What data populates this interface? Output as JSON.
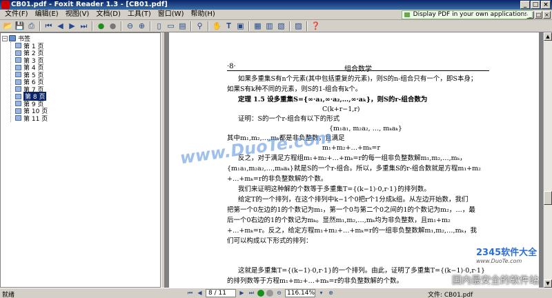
{
  "window": {
    "title": "CB01.pdf - Foxit Reader 1.3 - [CB01.pdf]",
    "controls": [
      "_",
      "□",
      "×"
    ]
  },
  "menu": {
    "items": [
      "文件(F)",
      "编辑(E)",
      "视图(V)",
      "文档(D)",
      "工具(T)",
      "窗口(W)",
      "帮助(H)"
    ],
    "promo": "Display PDF in your own applications"
  },
  "toolbar": {
    "icons": [
      "open-icon",
      "save-icon",
      "print-icon",
      "first-page-icon",
      "prev-page-icon",
      "next-page-icon",
      "last-page-icon",
      "go-back-icon",
      "go-forward-icon",
      "zoom-out-icon",
      "zoom-in-icon",
      "actual-size-icon",
      "fit-page-icon",
      "fit-width-icon",
      "find-icon",
      "hand-tool-icon",
      "text-select-icon",
      "snapshot-icon",
      "single-page-icon",
      "continuous-icon",
      "facing-icon",
      "bookmark-toggle-icon",
      "help-icon"
    ]
  },
  "bookmarks": {
    "root": "书签",
    "items": [
      {
        "label": "第 1 页",
        "selected": false
      },
      {
        "label": "第 2 页",
        "selected": false
      },
      {
        "label": "第 3 页",
        "selected": false
      },
      {
        "label": "第 4 页",
        "selected": false
      },
      {
        "label": "第 5 页",
        "selected": false
      },
      {
        "label": "第 6 页",
        "selected": false
      },
      {
        "label": "第 7 页",
        "selected": false
      },
      {
        "label": "第 8 页",
        "selected": true
      },
      {
        "label": "第 9 页",
        "selected": false
      },
      {
        "label": "第 10 页",
        "selected": false
      },
      {
        "label": "第 11 页",
        "selected": false
      }
    ]
  },
  "page": {
    "number": "·8·",
    "header_title": "组合数学",
    "lines": [
      "如果多重集S有n个元素(其中包括重复的元素)，则S的n-组合只有一个，即S本身；",
      "如果S有k种不同的元素，则S的1-组合有k个。",
      "定理 1.5   设多重集S={∞·a₁,∞·a₂,…,∞·aₖ}，则S的r-组合数为",
      "C(k+r−1,r)",
      "证明：S的一个r-组合有以下的形式",
      "{m₁a₁, m₂a₂, …, mₖaₖ}",
      "其中m₁,m₂,…,mₖ都是非负整数，且满足",
      "m₁+m₂+…+mₖ=r",
      "反之，对于满足方程组m₁+m₂+…+mₖ=r的每一组非负整数解m₁,m₂,…,mₖ，",
      "{m₁a₁,m₂a₂,…,mₖaₖ}就是S的一个r-组合。所以，多重集S的r-组合数就是方程m₁+m₂",
      "+…+mₖ=r的非负整数解的个数。",
      "我们来证明这种解的个数等于多重集T={(k−1)·0,r·1}的排列数。",
      "给定T的一个排列，在这个排列中k−1个0把r个1分成k组。从左边开始数，我们",
      "把第一个0左边的1的个数记为m₁，第一个0与第二个0之间的1的个数记为m₂，…，最",
      "后一个0右边的1的个数记为mₖ。显然m₁,m₂,…,mₖ均为非负整数，且m₁+m₂",
      "+…+mₖ=r。反之，给定方程m₁+m₂+…+mₖ=r的一组非负整数解m₁,m₂,…,mₖ，我",
      "们可以构成以下形式的排列：",
      "这就是多重集T={(k−1)·0,r·1}的一个排列。由此，证明了多重集T={(k−1)·0,r·1}",
      "的排列数等于方程m₁+m₂+…+mₖ=r的非负整数解的个数。"
    ]
  },
  "watermarks": {
    "duote_cn": "www.DuoTe.com",
    "software_2345": "2345软件大全",
    "software_2345_url": "www.DuoTe.com",
    "safest": "国内最安全的软件站"
  },
  "status": {
    "text": "就绪",
    "page_indicator": "8 / 11",
    "zoom": "116.14%",
    "file_label": "文件: CB01.pdf"
  }
}
